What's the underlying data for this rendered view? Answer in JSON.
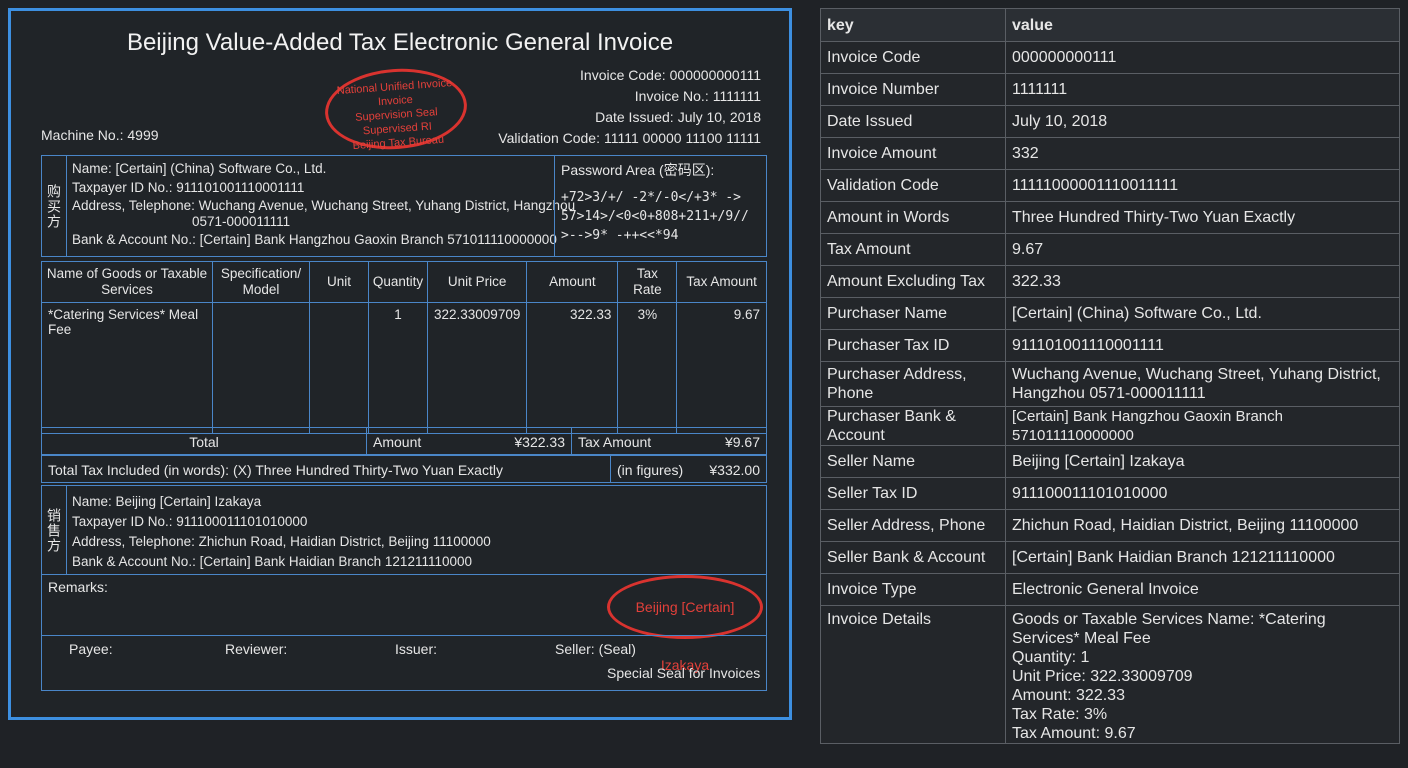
{
  "invoice": {
    "title": "Beijing Value-Added Tax Electronic General Invoice",
    "seal_top": [
      "National Unified Invoice",
      "Invoice",
      "Supervision Seal",
      "Supervised RI",
      "Beijing Tax Bureau"
    ],
    "codes": [
      {
        "label": "Invoice Code:",
        "value": "000000000111"
      },
      {
        "label": "Invoice No.:",
        "value": "1111111"
      },
      {
        "label": "Date Issued:",
        "value": "July 10, 2018"
      },
      {
        "label": "Validation Code:",
        "value": "11111 00000 11100 11111"
      }
    ],
    "machine_no": "Machine No.: 4999",
    "buyer": {
      "side_label": "购买方",
      "name": "Name: [Certain] (China) Software Co., Ltd.",
      "tax_id": "Taxpayer ID No.: 911101001110001111",
      "address_1": "Address, Telephone: Wuchang Avenue, Wuchang Street, Yuhang District, Hangzhou",
      "address_2": "0571-000011111",
      "bank": "Bank & Account No.: [Certain] Bank Hangzhou Gaoxin Branch 571011110000000"
    },
    "password_area": {
      "label": "Password Area (密码区):",
      "code": "+72>3/+/ -2*/-0</+3* ->\n57>14>/<0<0+808+211+/9//\n>-->9* -++<<*94"
    },
    "goods_headers": [
      "Name of Goods or Taxable Services",
      "Specification/ Model",
      "Unit",
      "Quantity",
      "Unit Price",
      "Amount",
      "Tax Rate",
      "Tax Amount"
    ],
    "goods_row": {
      "name": "*Catering Services* Meal Fee",
      "spec": "",
      "unit": "",
      "quantity": "1",
      "unit_price": "322.33009709",
      "amount": "322.33",
      "tax_rate": "3%",
      "tax_amount": "9.67"
    },
    "total": {
      "label": "Total",
      "amount_label": "Amount",
      "amount": "¥322.33",
      "tax_label": "Tax Amount",
      "tax": "¥9.67"
    },
    "words": {
      "text": "Total Tax Included (in words): (X) Three Hundred Thirty-Two Yuan Exactly",
      "figures_label": "(in figures)",
      "figures": "¥332.00"
    },
    "seller": {
      "side_label": "销售方",
      "name": "Name: Beijing [Certain] Izakaya",
      "tax_id": "Taxpayer ID No.: 911100011101010000",
      "address": "Address, Telephone: Zhichun Road, Haidian District, Beijing 11100000",
      "bank": "Bank & Account No.: [Certain] Bank Haidian Branch 121211110000"
    },
    "remarks": "Remarks:",
    "seal_bottom": "Beijing [Certain] Izakaya",
    "signatures": {
      "payee": "Payee:",
      "reviewer": "Reviewer:",
      "issuer": "Issuer:",
      "seller": "Seller: (Seal)",
      "special": "Special Seal for Invoices"
    }
  },
  "kv_table": {
    "headers": {
      "key": "key",
      "value": "value"
    },
    "rows": [
      {
        "key": "Invoice Code",
        "value": "000000000111"
      },
      {
        "key": "Invoice Number",
        "value": "1111111"
      },
      {
        "key": "Date Issued",
        "value": "July 10, 2018"
      },
      {
        "key": "Invoice Amount",
        "value": "332"
      },
      {
        "key": "Validation Code",
        "value": "11111000001110011111"
      },
      {
        "key": "Amount in Words",
        "value": "Three Hundred Thirty-Two Yuan Exactly"
      },
      {
        "key": "Tax Amount",
        "value": "9.67"
      },
      {
        "key": "Amount Excluding Tax",
        "value": "322.33"
      },
      {
        "key": "Purchaser Name",
        "value": "[Certain] (China) Software Co., Ltd."
      },
      {
        "key": "Purchaser Tax ID",
        "value": "911101001110001111"
      },
      {
        "key": "Purchaser Address, Phone",
        "value": "Wuchang Avenue, Wuchang Street, Yuhang District, Hangzhou 0571-000011111"
      },
      {
        "key": "Purchaser Bank & Account",
        "value": "[Certain] Bank Hangzhou Gaoxin Branch 571011110000000"
      },
      {
        "key": "Seller Name",
        "value": "Beijing [Certain] Izakaya"
      },
      {
        "key": "Seller Tax ID",
        "value": "911100011101010000"
      },
      {
        "key": "Seller Address, Phone",
        "value": "Zhichun Road, Haidian District, Beijing 11100000"
      },
      {
        "key": "Seller Bank & Account",
        "value": "[Certain] Bank Haidian Branch 121211110000"
      },
      {
        "key": "Invoice Type",
        "value": "Electronic General Invoice"
      }
    ],
    "details": {
      "key": "Invoice Details",
      "lines": [
        "Goods or Taxable Services Name: *Catering Services* Meal Fee",
        "Quantity: 1",
        "Unit Price: 322.33009709",
        "Amount: 322.33",
        "Tax Rate: 3%",
        "Tax Amount: 9.67"
      ]
    }
  }
}
